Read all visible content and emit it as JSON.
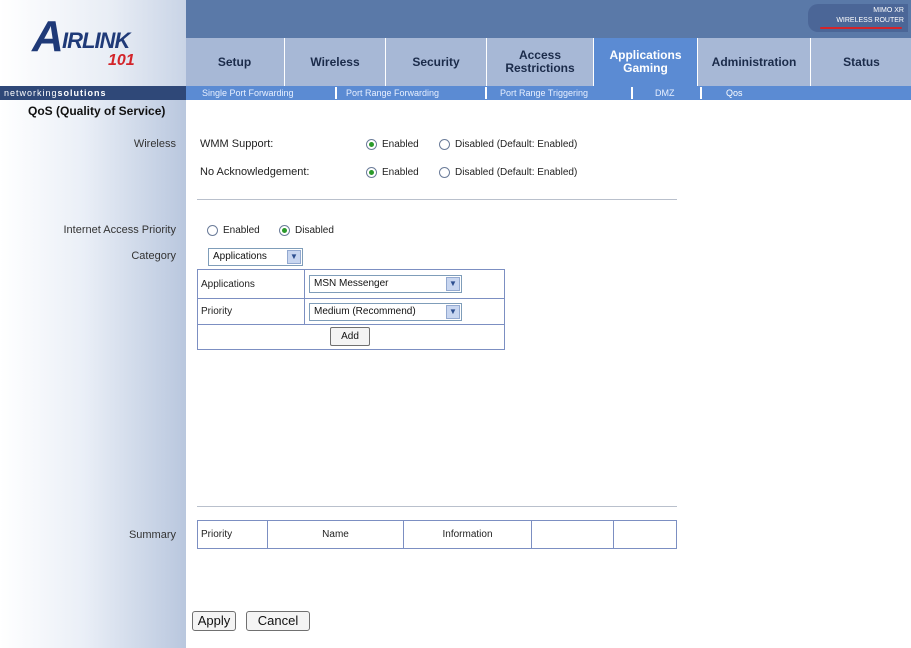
{
  "brand": {
    "logo_main": "IRLINK",
    "logo_letter": "A",
    "logo_sub": "101",
    "tagline_light": "networking",
    "tagline_bold": "solutions",
    "product_line1": "MIMO XR",
    "product_line2": "WIRELESS ROUTER"
  },
  "tabs": [
    {
      "label": "Setup"
    },
    {
      "label": "Wireless"
    },
    {
      "label": "Security"
    },
    {
      "label": "Access Restrictions"
    },
    {
      "label": "Applications Gaming"
    },
    {
      "label": "Administration"
    },
    {
      "label": "Status"
    }
  ],
  "subnav": [
    {
      "label": "Single Port Forwarding"
    },
    {
      "label": "Port Range Forwarding"
    },
    {
      "label": "Port Range Triggering"
    },
    {
      "label": "DMZ"
    },
    {
      "label": "Qos"
    }
  ],
  "section": {
    "title": "QoS (Quality of Service)"
  },
  "wireless": {
    "label": "Wireless",
    "wmm_label": "WMM Support:",
    "noack_label": "No Acknowledgement:",
    "enabled": "Enabled",
    "disabled_default": "Disabled (Default: Enabled)"
  },
  "priority": {
    "label": "Internet Access Priority",
    "enabled": "Enabled",
    "disabled": "Disabled"
  },
  "category": {
    "label": "Category",
    "value": "Applications"
  },
  "app_table": {
    "app_label": "Applications",
    "app_value": "MSN Messenger",
    "priority_label": "Priority",
    "priority_value": "Medium (Recommend)",
    "add_button": "Add"
  },
  "summary": {
    "label": "Summary",
    "columns": [
      "Priority",
      "Name",
      "Information",
      "",
      ""
    ]
  },
  "actions": {
    "apply": "Apply",
    "cancel": "Cancel"
  },
  "colors": {
    "tab_bg": "#a7b8d6",
    "active_tab": "#5b8bd3",
    "header_dark": "#5a79a8"
  }
}
